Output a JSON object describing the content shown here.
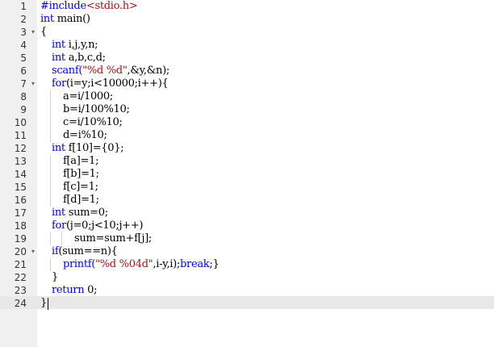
{
  "editor": {
    "active_line": 24,
    "lines": [
      {
        "num": "1",
        "fold": "",
        "indent": 0,
        "tokens": [
          {
            "t": "#include",
            "c": "pre"
          },
          {
            "t": "<stdio.h>",
            "c": "str"
          }
        ]
      },
      {
        "num": "2",
        "fold": "",
        "indent": 0,
        "tokens": [
          {
            "t": "int",
            "c": "kw"
          },
          {
            "t": " main()",
            "c": "txt"
          }
        ]
      },
      {
        "num": "3",
        "fold": "▾",
        "indent": 0,
        "tokens": [
          {
            "t": "{",
            "c": "txt"
          }
        ]
      },
      {
        "num": "4",
        "fold": "",
        "indent": 1,
        "tokens": [
          {
            "t": "int",
            "c": "kw"
          },
          {
            "t": " i,j,y,n;",
            "c": "txt"
          }
        ]
      },
      {
        "num": "5",
        "fold": "",
        "indent": 1,
        "tokens": [
          {
            "t": "int",
            "c": "kw"
          },
          {
            "t": " a,b,c,d;",
            "c": "txt"
          }
        ]
      },
      {
        "num": "6",
        "fold": "",
        "indent": 1,
        "tokens": [
          {
            "t": "scanf(",
            "c": "kw"
          },
          {
            "t": "\"%d %d\"",
            "c": "str"
          },
          {
            "t": ",&y,&n);",
            "c": "txt"
          }
        ]
      },
      {
        "num": "7",
        "fold": "▾",
        "indent": 1,
        "tokens": [
          {
            "t": "for",
            "c": "kw"
          },
          {
            "t": "(i=y;i<10000;i++){",
            "c": "txt"
          }
        ]
      },
      {
        "num": "8",
        "fold": "",
        "indent": 2,
        "tokens": [
          {
            "t": "a=i/1000;",
            "c": "txt"
          }
        ]
      },
      {
        "num": "9",
        "fold": "",
        "indent": 2,
        "tokens": [
          {
            "t": "b=i/100%10;",
            "c": "txt"
          }
        ]
      },
      {
        "num": "10",
        "fold": "",
        "indent": 2,
        "tokens": [
          {
            "t": "c=i/10%10;",
            "c": "txt"
          }
        ]
      },
      {
        "num": "11",
        "fold": "",
        "indent": 2,
        "tokens": [
          {
            "t": "d=i%10;",
            "c": "txt"
          }
        ]
      },
      {
        "num": "12",
        "fold": "",
        "indent": 1,
        "tokens": [
          {
            "t": "int",
            "c": "kw"
          },
          {
            "t": " f[10]={0};",
            "c": "txt"
          }
        ]
      },
      {
        "num": "13",
        "fold": "",
        "indent": 2,
        "tokens": [
          {
            "t": "f[a]=1;",
            "c": "txt"
          }
        ]
      },
      {
        "num": "14",
        "fold": "",
        "indent": 2,
        "tokens": [
          {
            "t": "f[b]=1;",
            "c": "txt"
          }
        ]
      },
      {
        "num": "15",
        "fold": "",
        "indent": 2,
        "tokens": [
          {
            "t": "f[c]=1;",
            "c": "txt"
          }
        ]
      },
      {
        "num": "16",
        "fold": "",
        "indent": 2,
        "tokens": [
          {
            "t": "f[d]=1;",
            "c": "txt"
          }
        ]
      },
      {
        "num": "17",
        "fold": "",
        "indent": 1,
        "tokens": [
          {
            "t": "int",
            "c": "kw"
          },
          {
            "t": " sum=0;",
            "c": "txt"
          }
        ]
      },
      {
        "num": "18",
        "fold": "",
        "indent": 1,
        "tokens": [
          {
            "t": "for",
            "c": "kw"
          },
          {
            "t": "(j=0;j<10;j++)",
            "c": "txt"
          }
        ]
      },
      {
        "num": "19",
        "fold": "",
        "indent": 3,
        "tokens": [
          {
            "t": "sum=sum+f[j];",
            "c": "txt"
          }
        ]
      },
      {
        "num": "20",
        "fold": "▾",
        "indent": 1,
        "tokens": [
          {
            "t": "if",
            "c": "kw"
          },
          {
            "t": "(sum==n){",
            "c": "txt"
          }
        ]
      },
      {
        "num": "21",
        "fold": "",
        "indent": 2,
        "tokens": [
          {
            "t": "printf(",
            "c": "kw"
          },
          {
            "t": "\"%d %04d\"",
            "c": "str"
          },
          {
            "t": ",i-y,i);",
            "c": "txt"
          },
          {
            "t": "break",
            "c": "kw"
          },
          {
            "t": ";}",
            "c": "txt"
          }
        ]
      },
      {
        "num": "22",
        "fold": "",
        "indent": 1,
        "tokens": [
          {
            "t": "}",
            "c": "txt"
          }
        ]
      },
      {
        "num": "23",
        "fold": "",
        "indent": 1,
        "tokens": [
          {
            "t": "return",
            "c": "kw"
          },
          {
            "t": " 0;",
            "c": "txt"
          }
        ]
      },
      {
        "num": "24",
        "fold": "",
        "indent": 0,
        "tokens": [
          {
            "t": "}",
            "c": "txt"
          }
        ]
      }
    ]
  }
}
